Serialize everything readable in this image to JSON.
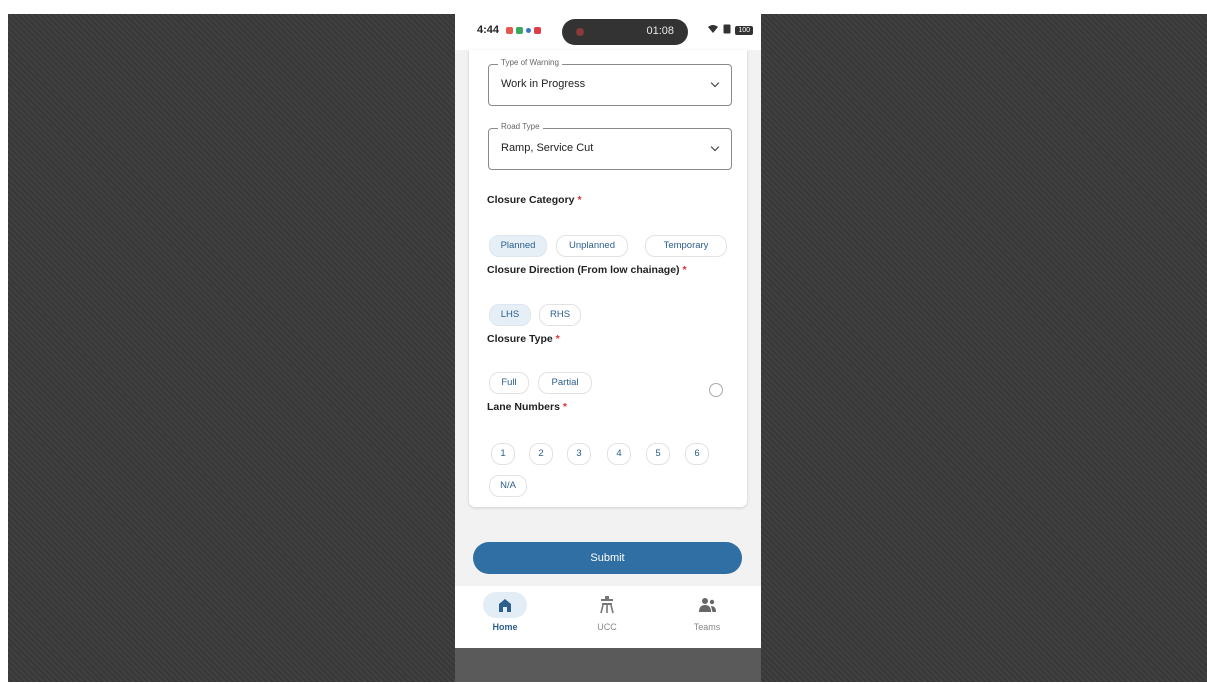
{
  "status_bar": {
    "time": "4:44",
    "recording_timer": "01:08",
    "battery": "100"
  },
  "form": {
    "type_of_warning": {
      "label": "Type of Warning",
      "value": "Work in Progress"
    },
    "road_type": {
      "label": "Road Type",
      "value": "Ramp, Service Cut"
    },
    "closure_category": {
      "title": "Closure Category",
      "required_mark": "*",
      "options": [
        "Planned",
        "Unplanned",
        "Temporary"
      ],
      "selected": "Planned"
    },
    "closure_direction": {
      "title": "Closure Direction (From low chainage)",
      "required_mark": "*",
      "options": [
        "LHS",
        "RHS"
      ],
      "selected": "LHS"
    },
    "closure_type": {
      "title": "Closure Type",
      "required_mark": "*",
      "options": [
        "Full",
        "Partial"
      ]
    },
    "lane_numbers": {
      "title": "Lane Numbers",
      "required_mark": "*",
      "options": [
        "1",
        "2",
        "3",
        "4",
        "5",
        "6",
        "N/A"
      ]
    },
    "submit_label": "Submit"
  },
  "bottom_nav": {
    "items": [
      {
        "label": "Home",
        "icon": "home-icon",
        "active": true
      },
      {
        "label": "UCC",
        "icon": "tower-icon",
        "active": false
      },
      {
        "label": "Teams",
        "icon": "team-icon",
        "active": false
      }
    ]
  },
  "colors": {
    "accent": "#2f6fa3",
    "chip_text": "#2c5f8d",
    "required": "#dd3333",
    "selected_chip_bg": "#e6eef6",
    "backdrop": "#3a3a3a"
  }
}
